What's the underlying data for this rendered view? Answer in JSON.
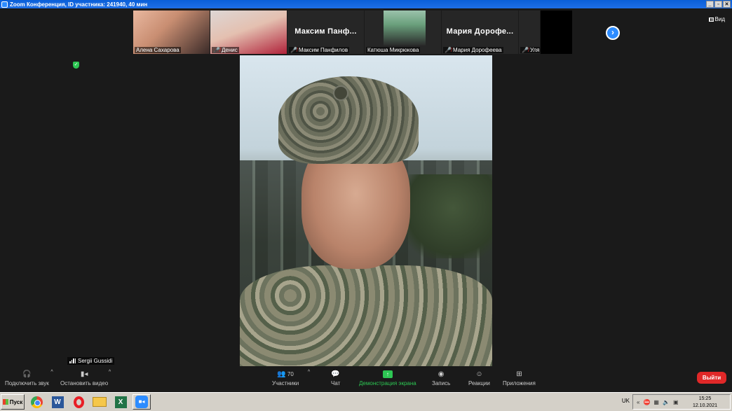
{
  "window": {
    "title": "Zoom Конференция, ID участника: 241940, 40 мин",
    "buttons": [
      "_",
      "▫",
      "✕"
    ]
  },
  "thumbnails": [
    {
      "name": "Алена Сахарова",
      "muted": false,
      "type": "photo1"
    },
    {
      "name": "Денис",
      "muted": true,
      "type": "photo2"
    },
    {
      "name": "Максим  Панфилов",
      "display": "Максим  Панф...",
      "muted": true,
      "type": "text"
    },
    {
      "name": "Катюша Микрюкова",
      "muted": false,
      "type": "photo3"
    },
    {
      "name": "Мария Дорофеева",
      "display": "Мария  Дорофе...",
      "muted": true,
      "type": "text"
    },
    {
      "name": "Уля",
      "muted": true,
      "type": "narrow"
    }
  ],
  "view_button": {
    "label": "Вид"
  },
  "main_speaker": {
    "name": "Sergii Gussidi"
  },
  "toolbar": {
    "audio": "Подключить звук",
    "video": "Остановить видео",
    "participants": "Участники",
    "participants_count": "70",
    "chat": "Чат",
    "share": "Демонстрация экрана",
    "record": "Запись",
    "reactions": "Реакции",
    "apps": "Приложения",
    "leave": "Выйти"
  },
  "taskbar": {
    "start": "Пуск",
    "language": "UK",
    "time": "15:25",
    "date": "12.10.2021"
  },
  "colors": {
    "zoom_blue": "#2d8cff",
    "share_green": "#2dc653",
    "leave_red": "#e02828"
  }
}
